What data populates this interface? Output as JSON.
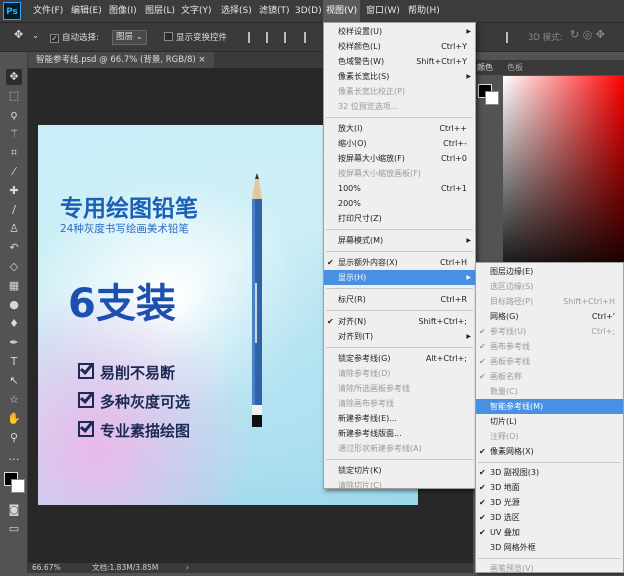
{
  "app": {
    "logo": "Ps"
  },
  "menubar": [
    "文件(F)",
    "编辑(E)",
    "图像(I)",
    "图层(L)",
    "文字(Y)",
    "选择(S)",
    "滤镜(T)",
    "3D(D)",
    "视图(V)",
    "窗口(W)",
    "帮助(H)"
  ],
  "options": {
    "auto_select": "自动选择:",
    "layer_select": "图层",
    "show_transform": "显示变换控件",
    "mode3d": "3D 模式:"
  },
  "document": {
    "tab": "智能参考线.psd @ 66.7% (背景, RGB/8)",
    "zoom": "66.67%",
    "docinfo": "文档:1.83M/3.85M"
  },
  "artwork": {
    "title": "专用绘图铅笔",
    "subtitle": "24种灰度书写绘画美术铅笔",
    "big": "6支装",
    "features": [
      "易削不易断",
      "多种灰度可选",
      "专业素描绘图"
    ]
  },
  "rpanel": {
    "tabs": [
      "颜色",
      "色板"
    ]
  },
  "view_menu": [
    {
      "label": "校样设置(U)",
      "arrow": true
    },
    {
      "label": "校样颜色(L)",
      "shortcut": "Ctrl+Y"
    },
    {
      "label": "色域警告(W)",
      "shortcut": "Shift+Ctrl+Y"
    },
    {
      "label": "像素长宽比(S)",
      "arrow": true
    },
    {
      "label": "像素长宽比校正(P)",
      "disabled": true
    },
    {
      "label": "32 位预览选项...",
      "disabled": true
    },
    {
      "sep": true
    },
    {
      "label": "放大(I)",
      "shortcut": "Ctrl++"
    },
    {
      "label": "缩小(O)",
      "shortcut": "Ctrl+-"
    },
    {
      "label": "按屏幕大小缩放(F)",
      "shortcut": "Ctrl+0"
    },
    {
      "label": "按屏幕大小缩放画板(F)",
      "disabled": true
    },
    {
      "label": "100%",
      "shortcut": "Ctrl+1"
    },
    {
      "label": "200%"
    },
    {
      "label": "打印尺寸(Z)"
    },
    {
      "sep": true
    },
    {
      "label": "屏幕模式(M)",
      "arrow": true
    },
    {
      "sep": true
    },
    {
      "label": "显示额外内容(X)",
      "shortcut": "Ctrl+H",
      "checked": true
    },
    {
      "label": "显示(H)",
      "arrow": true,
      "highlight": true
    },
    {
      "sep": true
    },
    {
      "label": "标尺(R)",
      "shortcut": "Ctrl+R"
    },
    {
      "sep": true
    },
    {
      "label": "对齐(N)",
      "shortcut": "Shift+Ctrl+;",
      "checked": true
    },
    {
      "label": "对齐到(T)",
      "arrow": true
    },
    {
      "sep": true
    },
    {
      "label": "锁定参考线(G)",
      "shortcut": "Alt+Ctrl+;"
    },
    {
      "label": "清除参考线(D)",
      "disabled": true
    },
    {
      "label": "清除所选画板参考线",
      "disabled": true
    },
    {
      "label": "清除画布参考线",
      "disabled": true
    },
    {
      "label": "新建参考线(E)..."
    },
    {
      "label": "新建参考线版面..."
    },
    {
      "label": "通过形状新建参考线(A)",
      "disabled": true
    },
    {
      "sep": true
    },
    {
      "label": "锁定切片(K)"
    },
    {
      "label": "清除切片(C)",
      "disabled": true
    }
  ],
  "show_menu": [
    {
      "label": "图层边缘(E)"
    },
    {
      "label": "选区边缘(S)",
      "disabled": true
    },
    {
      "label": "目标路径(P)",
      "shortcut": "Shift+Ctrl+H",
      "disabled": true
    },
    {
      "label": "网格(G)",
      "shortcut": "Ctrl+'"
    },
    {
      "label": "参考线(U)",
      "shortcut": "Ctrl+;",
      "checked": true,
      "disabled": true
    },
    {
      "label": "画布参考线",
      "checked": true,
      "disabled": true
    },
    {
      "label": "画板参考线",
      "checked": true,
      "disabled": true
    },
    {
      "label": "画板名称",
      "checked": true,
      "disabled": true
    },
    {
      "label": "数量(C)",
      "disabled": true
    },
    {
      "label": "智能参考线(M)",
      "highlight": true
    },
    {
      "label": "切片(L)"
    },
    {
      "label": "注释(O)",
      "disabled": true
    },
    {
      "label": "像素网格(X)",
      "checked": true
    },
    {
      "sep": true
    },
    {
      "label": "3D 副视图(3)",
      "checked": true
    },
    {
      "label": "3D 地面",
      "checked": true
    },
    {
      "label": "3D 光源",
      "checked": true
    },
    {
      "label": "3D 选区",
      "checked": true
    },
    {
      "label": "UV 叠加",
      "checked": true
    },
    {
      "label": "3D 网格外框"
    },
    {
      "sep": true
    },
    {
      "label": "画笔预览(V)",
      "disabled": true
    }
  ]
}
